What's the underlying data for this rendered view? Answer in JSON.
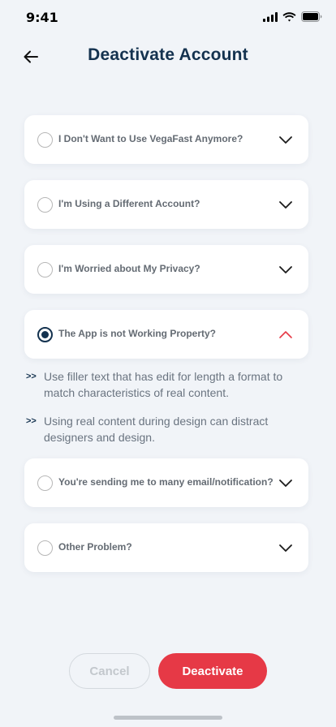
{
  "status_bar": {
    "time": "9:41"
  },
  "header": {
    "title": "Deactivate Account"
  },
  "reasons": [
    {
      "label": "I Don't Want to Use VegaFast Anymore?",
      "selected": false,
      "expanded": false
    },
    {
      "label": "I'm Using a Different Account?",
      "selected": false,
      "expanded": false
    },
    {
      "label": "I'm Worried about My Privacy?",
      "selected": false,
      "expanded": false
    },
    {
      "label": "The App is not Working Property?",
      "selected": true,
      "expanded": true,
      "details": [
        "Use filler text that has edit for length a format to match characteristics of real content.",
        "Using real content during design can distract designers and design."
      ]
    },
    {
      "label": "You're sending me to many email/notification?",
      "selected": false,
      "expanded": false
    },
    {
      "label": "Other Problem?",
      "selected": false,
      "expanded": false
    }
  ],
  "detail_bullet": ">>",
  "actions": {
    "cancel_label": "Cancel",
    "deactivate_label": "Deactivate"
  },
  "colors": {
    "accent": "#E63946",
    "primary": "#14324F",
    "background": "#F1F4F8"
  },
  "icons": {
    "back": "arrow-left-icon",
    "collapsed": "chevron-down-icon",
    "expanded": "chevron-up-icon"
  }
}
